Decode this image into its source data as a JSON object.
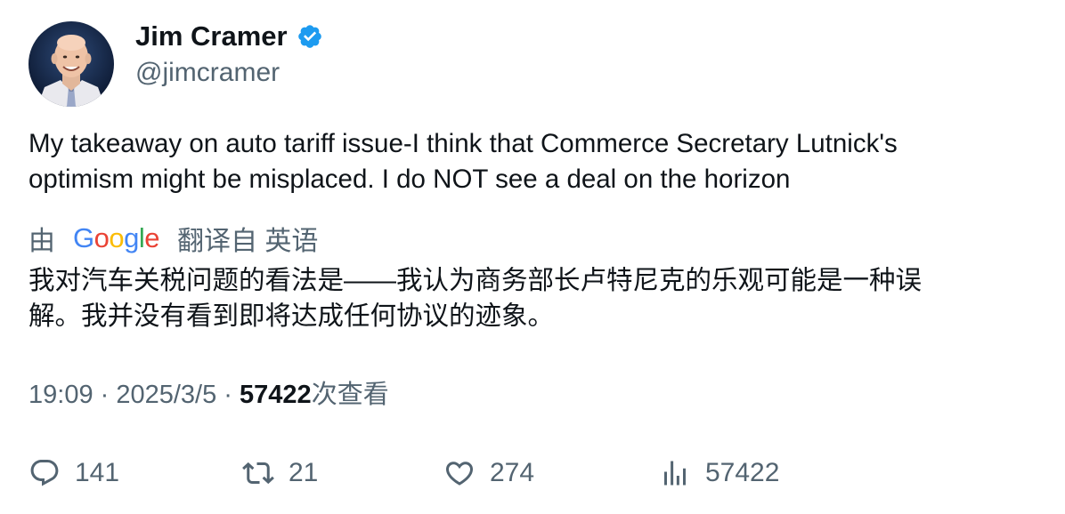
{
  "author": {
    "display_name": "Jim Cramer",
    "handle": "@jimcramer",
    "verified_icon": "verified-badge-icon",
    "verified_color": "#1d9bf0"
  },
  "tweet": {
    "text": "My takeaway on auto tariff issue-I think that Commerce Secretary Lutnick's\noptimism might be misplaced. I do NOT see a deal on the horizon"
  },
  "translation": {
    "prefix": "由",
    "provider": "Google",
    "suffix": "翻译自 英语",
    "text": "我对汽车关税问题的看法是——我认为商务部长卢特尼克的乐观可能是一种误\n解。我并没有看到即将达成任何协议的迹象。"
  },
  "meta": {
    "time": "19:09",
    "sep1": " · ",
    "date": "2025/3/5",
    "sep2": " · ",
    "views_count": "57422",
    "views_label": "次查看"
  },
  "actions": {
    "replies": "141",
    "retweets": "21",
    "likes": "274",
    "views": "57422"
  },
  "colors": {
    "text_primary": "#0f1419",
    "text_secondary": "#536471",
    "google_blue": "#4285f4",
    "google_red": "#ea4335",
    "google_yellow": "#fbbc05",
    "google_green": "#34a853"
  }
}
